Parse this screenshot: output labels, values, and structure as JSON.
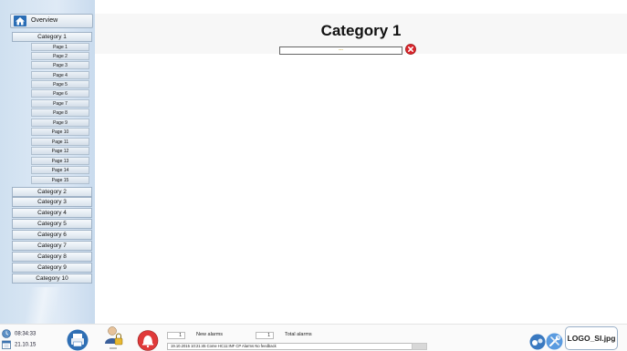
{
  "sidebar": {
    "overview_label": "Overview",
    "categories": [
      {
        "label": "Category 1"
      },
      {
        "label": "Category 2"
      },
      {
        "label": "Category 3"
      },
      {
        "label": "Category 4"
      },
      {
        "label": "Category 5"
      },
      {
        "label": "Category 6"
      },
      {
        "label": "Category 7"
      },
      {
        "label": "Category 8"
      },
      {
        "label": "Category 9"
      },
      {
        "label": "Category 10"
      }
    ],
    "pages": [
      {
        "label": "Page 1"
      },
      {
        "label": "Page 2"
      },
      {
        "label": "Page 3"
      },
      {
        "label": "Page 4"
      },
      {
        "label": "Page 5"
      },
      {
        "label": "Page 6"
      },
      {
        "label": "Page 7"
      },
      {
        "label": "Page 8"
      },
      {
        "label": "Page 9"
      },
      {
        "label": "Page 10"
      },
      {
        "label": "Page 11"
      },
      {
        "label": "Page 12"
      },
      {
        "label": "Page 13"
      },
      {
        "label": "Page 14"
      },
      {
        "label": "Page 15"
      }
    ]
  },
  "main": {
    "title": "Category 1",
    "filter_value": "---"
  },
  "footer": {
    "time": "08:34:33",
    "date": "21.10.15",
    "new_alarms_count": "1",
    "new_alarms_label": "New alarms",
    "total_alarms_count": "1",
    "total_alarms_label": "Total alarms",
    "alarm_message": "19.10.2015 10:21:45 Come HC11:INF CP Alarms No feedback",
    "logo_text": "LOGO_SI.jpg"
  },
  "colors": {
    "sidebar_bg": "#d6e4f2",
    "clear_button": "#d9242b",
    "alarm_button": "#e03a3a"
  }
}
